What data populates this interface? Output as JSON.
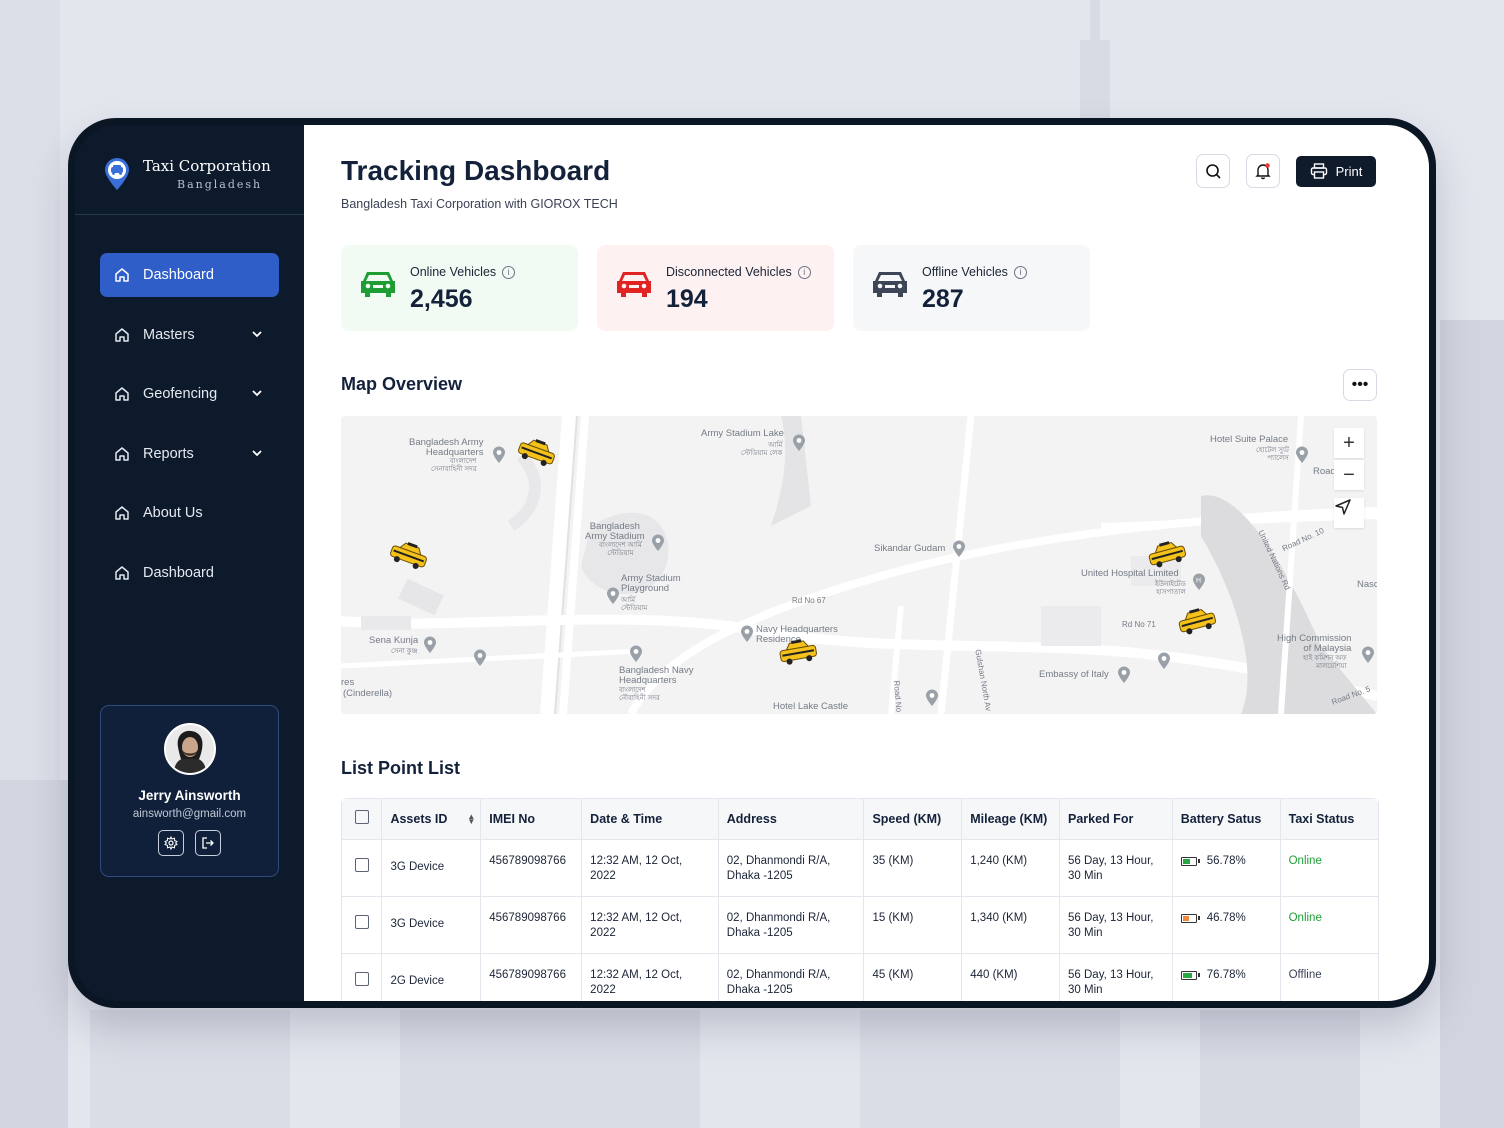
{
  "brand": {
    "name": "Taxi Corporation",
    "subtitle": "Bangladesh"
  },
  "sidebar": {
    "items": [
      {
        "label": "Dashboard",
        "icon": "home-icon",
        "active": true,
        "expandable": false
      },
      {
        "label": "Masters",
        "icon": "home-icon",
        "active": false,
        "expandable": true
      },
      {
        "label": "Geofencing",
        "icon": "home-icon",
        "active": false,
        "expandable": true
      },
      {
        "label": "Reports",
        "icon": "home-icon",
        "active": false,
        "expandable": true
      },
      {
        "label": "About Us",
        "icon": "home-icon",
        "active": false,
        "expandable": false
      },
      {
        "label": "Dashboard",
        "icon": "home-icon",
        "active": false,
        "expandable": false
      }
    ]
  },
  "user": {
    "name": "Jerry Ainsworth",
    "email": "ainsworth@gmail.com"
  },
  "header": {
    "title": "Tracking Dashboard",
    "subtitle": "Bangladesh Taxi Corporation with GIOROX TECH",
    "print_label": "Print"
  },
  "stats": [
    {
      "label": "Online Vehicles",
      "value": "2,456",
      "color": "#1f9d35",
      "bg": "#f2fbf3"
    },
    {
      "label": "Disconnected Vehicles",
      "value": "194",
      "color": "#e02424",
      "bg": "#fdf1f1"
    },
    {
      "label": "Offline Vehicles",
      "value": "287",
      "color": "#3c4656",
      "bg": "#f6f7f8"
    }
  ],
  "map": {
    "title": "Map Overview",
    "labels": {
      "army_hq": "Bangladesh Army\nHeadquarters",
      "army_hq_bn": "বাংলাদেশ\nসেনাবাহিনী সদর",
      "stadium_lake": "Army Stadium Lake",
      "stadium_lake_bn": "আর্মি\nস্টেডিয়াম লেক",
      "hotel_suite": "Hotel Suite Palace",
      "hotel_suite_bn": "হোটেল স্যুট\nপ্যালেস",
      "army_stadium": "Bangladesh\nArmy Stadium",
      "army_stadium_bn": "বাংলাদেশ আর্মি\nস্টেডিয়াম",
      "playground": "Army Stadium\nPlayground",
      "playground_bn": "আর্মি\nস্টেডিয়াম",
      "sikandar": "Sikandar Gudam",
      "united_hospital": "United Hospital Limited",
      "united_hospital_bn": "ইউনাইটেড\nহাসপাতাল",
      "road10": "Road No. 10",
      "un_rd": "United Nations Rd",
      "nasc": "Nasc",
      "rd67": "Rd No 67",
      "rd71": "Rd No 71",
      "navy_res": "Navy Headquarters\nResidence",
      "sena_kunja": "Sena Kunja",
      "sena_kunja_bn": "সেনা কুঞ্জ",
      "navy_hq": "Bangladesh Navy\nHeadquarters",
      "navy_hq_bn": "বাংলাদেশ\nনৌবাহিনী সদর",
      "cinderella": "(Cinderella)",
      "res": "res",
      "high_commission": "High Commission\nof Malaysia",
      "high_commission_bn": "হাই কমিশন অফ\nমালয়েশিয়া",
      "embassy_italy": "Embassy of Italy",
      "hotel_lake": "Hotel Lake Castle",
      "gulshan": "Gulshan North Av",
      "road_no": "Road No",
      "road5": "Road No. 5",
      "road": "Road"
    },
    "controls": {
      "zoom_in": "+",
      "zoom_out": "−"
    }
  },
  "list": {
    "title": "List Point List",
    "columns": [
      "Assets ID",
      "IMEI No",
      "Date & Time",
      "Address",
      "Speed (KM)",
      "Mileage (KM)",
      "Parked For",
      "Battery Satus",
      "Taxi Status"
    ],
    "rows": [
      {
        "asset": "3G Device",
        "imei": "456789098766",
        "datetime": "12:32 AM, 12 Oct, 2022",
        "address_1": "02, Dhanmondi R/A,",
        "address_2": "Dhaka -1205",
        "speed": "35 (KM)",
        "mileage": "1,240 (KM)",
        "parked_1": "56 Day, 13 Hour,",
        "parked_2": "30 Min",
        "battery": "56.78%",
        "battery_color": "#2aa745",
        "battery_level": 0.6,
        "status": "Online",
        "status_color": "#1f9d35"
      },
      {
        "asset": "3G Device",
        "imei": "456789098766",
        "datetime": "12:32 AM, 12 Oct, 2022",
        "address_1": "02, Dhanmondi R/A,",
        "address_2": "Dhaka -1205",
        "speed": "15 (KM)",
        "mileage": "1,340 (KM)",
        "parked_1": "56 Day, 13 Hour,",
        "parked_2": "30 Min",
        "battery": "46.78%",
        "battery_color": "#f08a3c",
        "battery_level": 0.5,
        "status": "Online",
        "status_color": "#1f9d35"
      },
      {
        "asset": "2G Device",
        "imei": "456789098766",
        "datetime": "12:32 AM, 12 Oct, 2022",
        "address_1": "02, Dhanmondi R/A,",
        "address_2": "Dhaka -1205",
        "speed": "45 (KM)",
        "mileage": "440 (KM)",
        "parked_1": "56 Day, 13 Hour,",
        "parked_2": "30 Min",
        "battery": "76.78%",
        "battery_color": "#2aa745",
        "battery_level": 0.8,
        "status": "Offline",
        "status_color": "#3a4255"
      }
    ]
  }
}
